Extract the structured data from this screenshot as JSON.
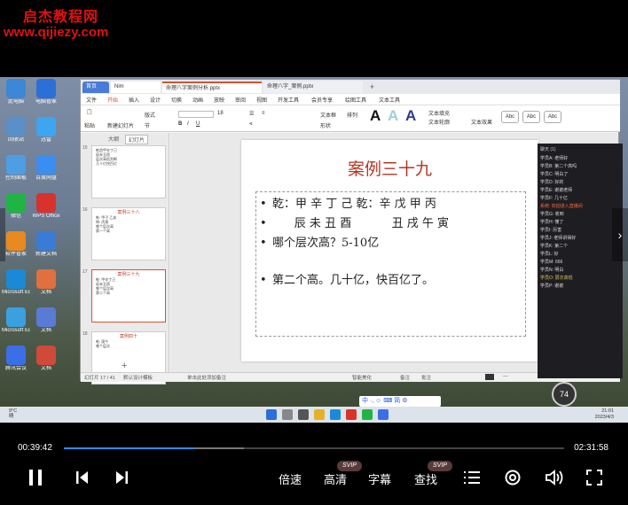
{
  "watermark": {
    "line1": "启杰教程网",
    "line2": "www.qijiezy.com"
  },
  "desktop_icons": [
    {
      "label": "此电脑",
      "color": "#3c87d6"
    },
    {
      "label": "电脑管家",
      "color": "#2b6fd8"
    },
    {
      "label": "回收站",
      "color": "#5a8fc7"
    },
    {
      "label": "迅雷",
      "color": "#3da6f0"
    },
    {
      "label": "控制面板",
      "color": "#4d9ee3"
    },
    {
      "label": "百度网盘",
      "color": "#3a8ef0"
    },
    {
      "label": "微信",
      "color": "#20b444"
    },
    {
      "label": "WPS Office",
      "color": "#d9322c"
    },
    {
      "label": "软件管家",
      "color": "#e88a1f"
    },
    {
      "label": "新建文档",
      "color": "#3a7bd5"
    },
    {
      "label": "Microsoft Edge",
      "color": "#1a8ad6"
    },
    {
      "label": "文档",
      "color": "#e07040"
    },
    {
      "label": "Microsoft Edge",
      "color": "#3aa0e0"
    },
    {
      "label": "文档",
      "color": "#5a7bd5"
    },
    {
      "label": "腾讯会议",
      "color": "#3b6fe8"
    },
    {
      "label": "文档",
      "color": "#d04a3a"
    }
  ],
  "wps": {
    "tabs": {
      "home": "首页",
      "t1": "Nim",
      "t2": "命理八字案例分析.pptx",
      "t3": "命理八字_案例.pptx",
      "plus": "+"
    },
    "menu": [
      "文件",
      "开始",
      "插入",
      "设计",
      "切换",
      "动画",
      "放映",
      "审阅",
      "视图",
      "开发工具",
      "会员专享",
      "绘图工具",
      "文本工具"
    ],
    "menu_active": "开始",
    "tools": {
      "paste": "粘贴",
      "new_slide": "新建幻灯片",
      "layout": "版式",
      "section": "节",
      "font_size": "18",
      "text_box": "文本框",
      "shapes": "形状",
      "arrange": "排列",
      "styles": [
        "Abc",
        "Abc",
        "Abc"
      ],
      "fill": "文本填充",
      "outline": "文本轮廓",
      "effects": "文本效果"
    },
    "thumb_tabs": [
      "大纲",
      "幻灯片"
    ],
    "thumbnails": [
      {
        "num": "15",
        "title": "",
        "lines": [
          "乾造甲辛丁己",
          "辰未丑酉",
          "层次高低判断",
          "几十亿快百亿"
        ]
      },
      {
        "num": "16",
        "title": "案例三十八",
        "lines": [
          "乾: 甲子 乙亥",
          "坤: 丙寅",
          "哪个层次高",
          "第一个高"
        ]
      },
      {
        "num": "17",
        "title": "案例三十九",
        "lines": [
          "乾: 甲辛丁己",
          "辰未丑酉",
          "哪个层次高",
          "第二个高"
        ]
      },
      {
        "num": "18",
        "title": "案例四十",
        "lines": [
          "乾: 庚午",
          "哪个层次"
        ]
      }
    ],
    "thumb_add": "+",
    "slide": {
      "title": "案例三十九",
      "lines": [
        {
          "bullet": "•",
          "text": "乾：甲 辛 丁 己     乾：辛 戊 甲 丙"
        },
        {
          "bullet": "•",
          "text": "      辰 未 丑 酉           丑 戌 午 寅"
        },
        {
          "bullet": "•",
          "text": "哪个层次高？5-10亿"
        },
        {
          "bullet": "•",
          "text": "第二个高。几十亿，快百亿了。"
        }
      ]
    },
    "status": {
      "slide_count": "幻灯片 17 / 41",
      "theme": "默认设计模板",
      "notes": "单击此处添加备注",
      "smart": "智能美化",
      "note_btn": "备注",
      "comment": "批注",
      "zoom": "—"
    }
  },
  "chat": {
    "header": "聊天 (1)",
    "lines": [
      {
        "text": "学员A: 老师好",
        "style": "normal"
      },
      {
        "text": "学员B: 第二个高吗",
        "style": "normal"
      },
      {
        "text": "学员C: 明白了",
        "style": "normal"
      },
      {
        "text": "学员D: 好的",
        "style": "normal"
      },
      {
        "text": "学员E: 谢谢老师",
        "style": "normal"
      },
      {
        "text": "学员F: 几十亿",
        "style": "normal"
      },
      {
        "text": "系统: 欢迎进入直播间",
        "style": "hl"
      },
      {
        "text": "学员G: 收到",
        "style": "normal"
      },
      {
        "text": "学员H: 懂了",
        "style": "normal"
      },
      {
        "text": "学员I: 厉害",
        "style": "normal"
      },
      {
        "text": "学员J: 老师讲得好",
        "style": "normal"
      },
      {
        "text": "学员K: 第二个",
        "style": "normal"
      },
      {
        "text": "学员L: 好",
        "style": "normal"
      },
      {
        "text": "学员M: 666",
        "style": "normal"
      },
      {
        "text": "学员N: 明白",
        "style": "normal"
      },
      {
        "text": "学员O: 层次高低",
        "style": "yl"
      },
      {
        "text": "学员P: 谢谢",
        "style": "normal"
      }
    ]
  },
  "volume_badge": "74",
  "ime": "中 ·, ☺ ⌨ 简 ⚙",
  "taskbar": {
    "weather_temp": "9°C",
    "weather_desc": "晴",
    "time": "21:01",
    "date": "2023/4/3"
  },
  "player": {
    "current_time": "00:39:42",
    "total_time": "02:31:58",
    "progress": 0.261,
    "buffered": 0.36,
    "speed_label": "倍速",
    "quality_label": "高清",
    "subtitle_label": "字幕",
    "search_label": "查找",
    "svip_badge": "SVIP",
    "colors": {
      "accent": "#2f8cff",
      "text": "#ffffff",
      "bg": "#000000"
    }
  }
}
